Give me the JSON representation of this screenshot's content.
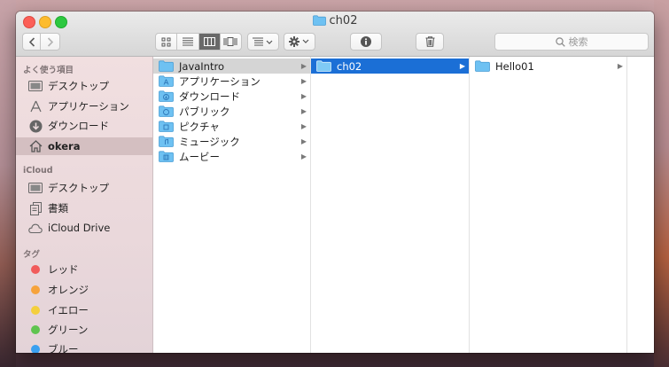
{
  "window": {
    "title": "ch02"
  },
  "toolbar": {
    "back_icon": "chevron-left-icon",
    "forward_icon": "chevron-right-icon",
    "views": [
      "icon-view",
      "list-view",
      "column-view",
      "coverflow-view"
    ],
    "active_view": "column-view",
    "search_placeholder": "検索"
  },
  "sidebar": {
    "favorites_heading": "よく使う項目",
    "favorites": [
      {
        "label": "デスクトップ",
        "icon": "desktop-icon"
      },
      {
        "label": "アプリケーション",
        "icon": "applications-icon"
      },
      {
        "label": "ダウンロード",
        "icon": "download-icon"
      },
      {
        "label": "okera",
        "icon": "home-icon",
        "selected": true
      }
    ],
    "icloud_heading": "iCloud",
    "icloud": [
      {
        "label": "デスクトップ",
        "icon": "desktop-icon"
      },
      {
        "label": "書類",
        "icon": "documents-icon"
      },
      {
        "label": "iCloud Drive",
        "icon": "cloud-icon"
      }
    ],
    "tags_heading": "タグ",
    "tags": [
      {
        "label": "レッド",
        "color": "#f15b5b"
      },
      {
        "label": "オレンジ",
        "color": "#f6a33c"
      },
      {
        "label": "イエロー",
        "color": "#f4cf3d"
      },
      {
        "label": "グリーン",
        "color": "#5fc44f"
      },
      {
        "label": "ブルー",
        "color": "#3aa0f0"
      }
    ]
  },
  "columns": {
    "col1": [
      {
        "label": "JavaIntro",
        "state": "dim"
      },
      {
        "label": "アプリケーション"
      },
      {
        "label": "ダウンロード"
      },
      {
        "label": "パブリック"
      },
      {
        "label": "ピクチャ"
      },
      {
        "label": "ミュージック"
      },
      {
        "label": "ムービー"
      }
    ],
    "col2": [
      {
        "label": "ch02",
        "state": "selected"
      }
    ],
    "col3": [
      {
        "label": "Hello01"
      }
    ]
  },
  "colors": {
    "selection_blue": "#1b6fd6",
    "folder_blue": "#6ec1f2"
  }
}
